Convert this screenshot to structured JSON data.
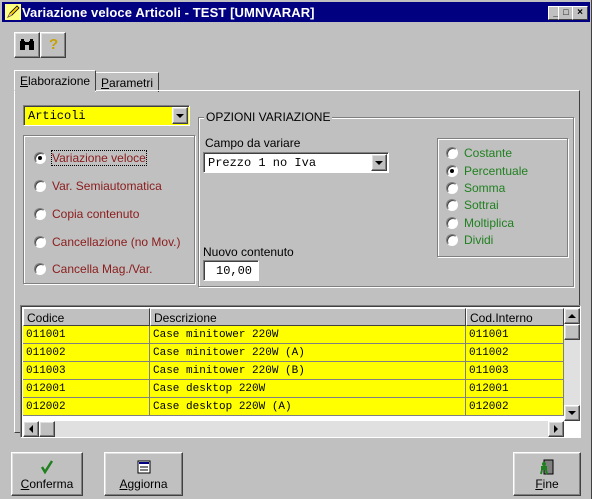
{
  "window": {
    "title": "Variazione veloce Articoli - TEST [UMNVARAR]",
    "controls": [
      "_",
      "□",
      "×"
    ]
  },
  "toolbar": {
    "tools": [
      {
        "name": "binoculars-icon",
        "glyph": "👓"
      },
      {
        "name": "help-icon",
        "glyph": "?"
      }
    ]
  },
  "tabs": [
    {
      "label_first": "E",
      "label_rest": "laborazione"
    },
    {
      "label_first": "P",
      "label_rest": "arametri"
    }
  ],
  "archive_select": {
    "value": "Articoli"
  },
  "operations": {
    "items": [
      {
        "label": "Variazione veloce",
        "selected": true
      },
      {
        "label": "Var. Semiautomatica",
        "selected": false
      },
      {
        "label": "Copia contenuto",
        "selected": false
      },
      {
        "label": "Cancellazione (no Mov.)",
        "selected": false
      },
      {
        "label": "Cancella Mag./Var.",
        "selected": false
      }
    ]
  },
  "options": {
    "group_title": "OPZIONI VARIAZIONE",
    "field_label": "Campo da variare",
    "field_value": "Prezzo 1 no Iva",
    "new_content_label": "Nuovo contenuto",
    "new_content_value": "10,00",
    "modes": [
      {
        "label": "Costante",
        "selected": false
      },
      {
        "label": "Percentuale",
        "selected": true
      },
      {
        "label": "Somma",
        "selected": false
      },
      {
        "label": "Sottrai",
        "selected": false
      },
      {
        "label": "Moltiplica",
        "selected": false
      },
      {
        "label": "Dividi",
        "selected": false
      }
    ]
  },
  "table": {
    "columns": [
      "Codice",
      "Descrizione",
      "Cod.Interno"
    ],
    "rows": [
      [
        "011001",
        "Case minitower 220W",
        "011001"
      ],
      [
        "011002",
        "Case minitower 220W (A)",
        "011002"
      ],
      [
        "011003",
        "Case minitower 220W (B)",
        "011003"
      ],
      [
        "012001",
        "Case desktop 220W",
        "012001"
      ],
      [
        "012002",
        "Case desktop 220W (A)",
        "012002"
      ]
    ],
    "row_color": "#ffff00"
  },
  "buttons": {
    "confirm": {
      "first": "C",
      "rest": "onferma"
    },
    "refresh": {
      "first": "A",
      "rest": "ggiorna"
    },
    "end": {
      "first": "F",
      "rest": "ine"
    }
  },
  "colors": {
    "titlebar": "#000080",
    "highlight": "#ffff00",
    "brown_text": "#8b1c1c",
    "green_text": "#208020"
  }
}
